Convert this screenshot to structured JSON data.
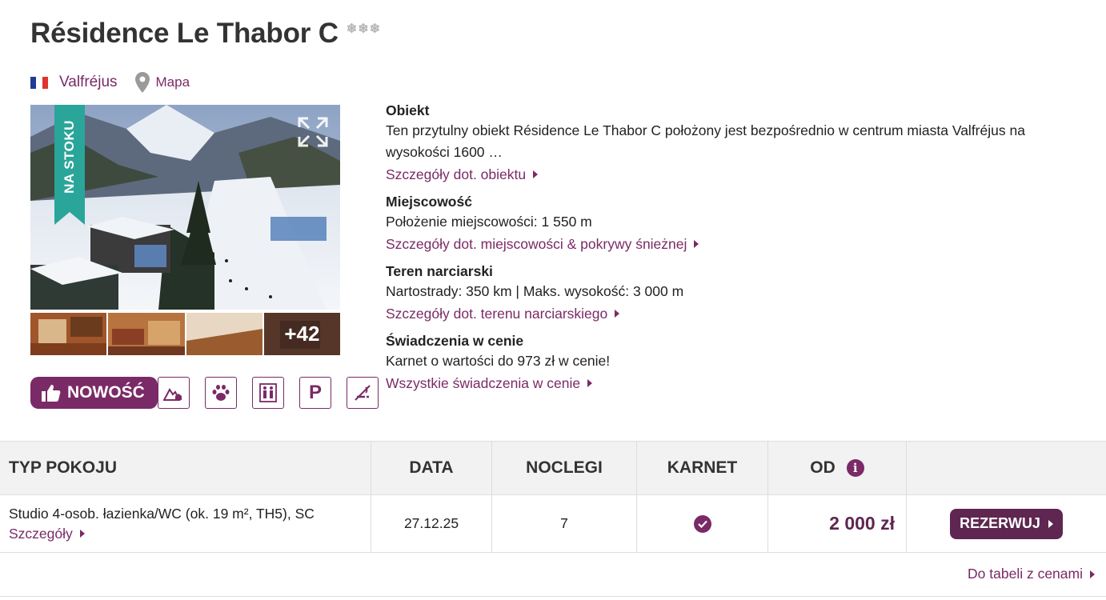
{
  "hotel": {
    "name": "Résidence Le Thabor C",
    "stars": "❄❄❄",
    "location": "Valfréjus",
    "map_label": "Mapa"
  },
  "gallery": {
    "ribbon_label": "NA STOKU",
    "more_photos": "+42"
  },
  "badges": {
    "new_label": "NOWOŚĆ",
    "features": [
      "mountain-view-icon",
      "pets-allowed-icon",
      "elevator-icon",
      "parking-icon",
      "non-smoking-icon"
    ],
    "parking_letter": "P"
  },
  "info": {
    "property": {
      "heading": "Obiekt",
      "text": "Ten przytulny obiekt Résidence Le Thabor C położony jest bezpośrednio w centrum miasta Valfréjus na wysokości 1600 …",
      "link": "Szczegóły dot. obiektu"
    },
    "resort": {
      "heading": "Miejscowość",
      "text": "Położenie miejscowości: 1 550 m",
      "link": "Szczegóły dot. miejscowości & pokrywy śnieżnej"
    },
    "ski_area": {
      "heading": "Teren narciarski",
      "text": "Nartostrady: 350 km | Maks. wysokość: 3 000 m",
      "link": "Szczegóły dot. terenu narciarskiego"
    },
    "benefits": {
      "heading": "Świadczenia w cenie",
      "text": "Karnet o wartości do 973 zł w cenie!",
      "link": "Wszystkie świadczenia w cenie"
    }
  },
  "table": {
    "headers": {
      "room_type": "TYP POKOJU",
      "date": "DATA",
      "nights": "NOCLEGI",
      "pass": "KARNET",
      "from": "OD"
    },
    "rows": [
      {
        "room": "Studio 4-osob. łazienka/WC (ok. 19 m², TH5), SC",
        "details": "Szczegóły",
        "date": "27.12.25",
        "nights": "7",
        "pass_included": true,
        "price": "2 000 zł",
        "book": "REZERWUJ"
      }
    ],
    "footer_link": "Do tabeli z cenami"
  },
  "colors": {
    "accent": "#7a2a66",
    "accent_dark": "#5e2650",
    "ribbon": "#2aa59a"
  }
}
